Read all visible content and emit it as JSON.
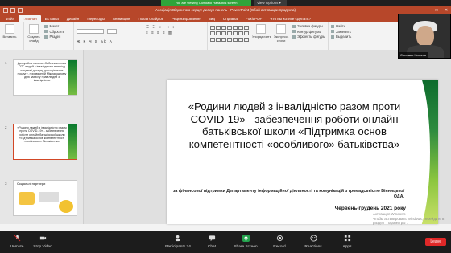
{
  "zoom": {
    "share_banner": "You are viewing Соломко Наталія's screen",
    "view_options": "View Options ▾",
    "toolbar": {
      "mute": "Unmute",
      "video": "Stop Video",
      "participants": "Participants",
      "participants_count": "74",
      "chat": "Chat",
      "share": "Share Screen",
      "record": "Record",
      "reactions": "Reactions",
      "apps": "Apps",
      "leave": "Leave"
    },
    "video_name": "Соломко Наталія"
  },
  "ppt": {
    "title": "Асоціація Відкритого серця: дискус панель - PowerPoint (Сбой активации продукта)",
    "tabs": [
      "Файл",
      "Главная",
      "Вставка",
      "Дизайн",
      "Переходы",
      "Анимация",
      "Показ слайдов",
      "Рецензирование",
      "Вид",
      "Справка",
      "Foxit PDF",
      "Что вы хотите сделать?"
    ],
    "active_tab": "Главная",
    "ribbon": {
      "paste": "Вставить",
      "create_slide": "Создать слайд",
      "layout": "Макет",
      "reset": "Сбросить",
      "section": "Раздел",
      "groups": [
        "Буфер обмена",
        "Слайды",
        "Шрифт",
        "Абзац",
        "Рисование",
        "Редактирование"
      ],
      "arrange": "Упорядочить",
      "quick_styles": "Экспресс-стили",
      "fill": "Заливка фигуры",
      "outline": "Контур фигуры",
      "effects": "Эффекты фигуры",
      "find": "Найти",
      "replace": "Заменить",
      "select": "Выделить"
    },
    "slides": [
      {
        "num": "1",
        "text": "Дискусійна панель «Забезпечення в ОТГ людей з інвалідністю в період пандемії доступу до соціальних послуг», присвяченій Міжнародному дню захисту прав людей з інвалідністю"
      },
      {
        "num": "2",
        "text": "«Родини людей з інвалідністю разом проти COVID-19» - забезпечення роботи онлайн батьківської школи «Підтримка основ компетентності «особливого» батьківства»"
      },
      {
        "num": "3",
        "text": "Соціальні партнери"
      }
    ],
    "main_slide": {
      "title": "«Родини людей  з інвалідністю разом проти COVID-19» - забезпечення роботи онлайн батьківської школи «Підтримка основ компетентності «особливого» батьківства»",
      "subtitle": "за фінансової підтримки Департаменту інформаційної діяльності та комунікацій з громадськістю Вінницької ОДА.",
      "date": "Червень-грудень 2021 року"
    },
    "watermark": "Активация Windows\nЧтобы активировать Windows, перейдите в раздел \"Параметры\"."
  }
}
